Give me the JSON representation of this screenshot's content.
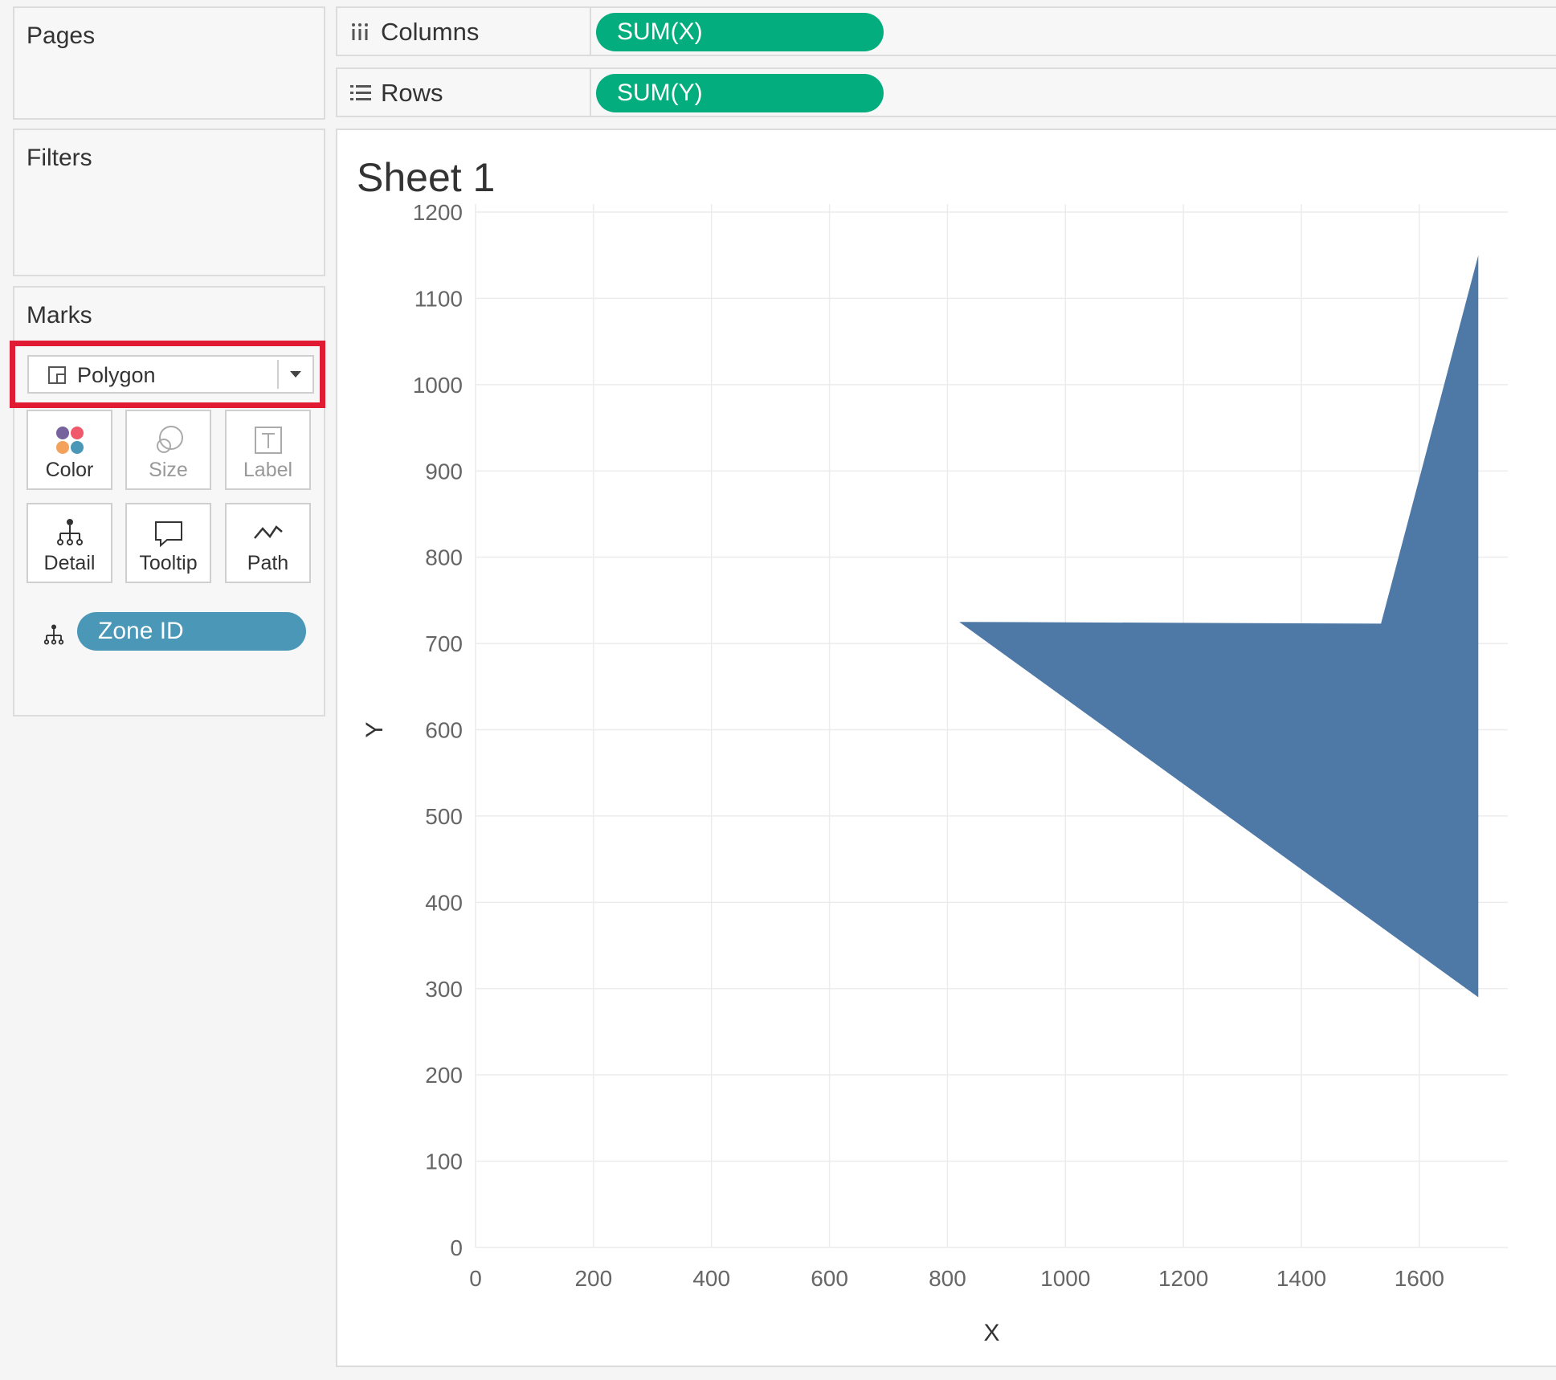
{
  "pages": {
    "title": "Pages"
  },
  "filters": {
    "title": "Filters"
  },
  "marks": {
    "title": "Marks",
    "mark_type": "Polygon",
    "buttons": {
      "color": "Color",
      "size": "Size",
      "label": "Label",
      "detail": "Detail",
      "tooltip": "Tooltip",
      "path": "Path"
    },
    "detail_pill": "Zone ID"
  },
  "shelves": {
    "columns": {
      "label": "Columns",
      "pill": "SUM(X)"
    },
    "rows": {
      "label": "Rows",
      "pill": "SUM(Y)"
    }
  },
  "sheet": {
    "title": "Sheet 1"
  },
  "colors": {
    "pill_green": "#03ad7e",
    "pill_blue": "#4a97b8",
    "polygon": "#4e79a7",
    "highlight": "#e11b33"
  },
  "chart_data": {
    "type": "polygon",
    "xlabel": "X",
    "ylabel": "Y",
    "xlim": [
      0,
      1750
    ],
    "ylim": [
      0,
      1200
    ],
    "x_ticks": [
      0,
      200,
      400,
      600,
      800,
      1000,
      1200,
      1400,
      1600
    ],
    "y_ticks": [
      0,
      100,
      200,
      300,
      400,
      500,
      600,
      700,
      800,
      900,
      1000,
      1100,
      1200
    ],
    "grid": true,
    "polygon_points": [
      {
        "x": 1700,
        "y": 1150
      },
      {
        "x": 1700,
        "y": 290
      },
      {
        "x": 820,
        "y": 725
      },
      {
        "x": 1535,
        "y": 723
      }
    ]
  }
}
